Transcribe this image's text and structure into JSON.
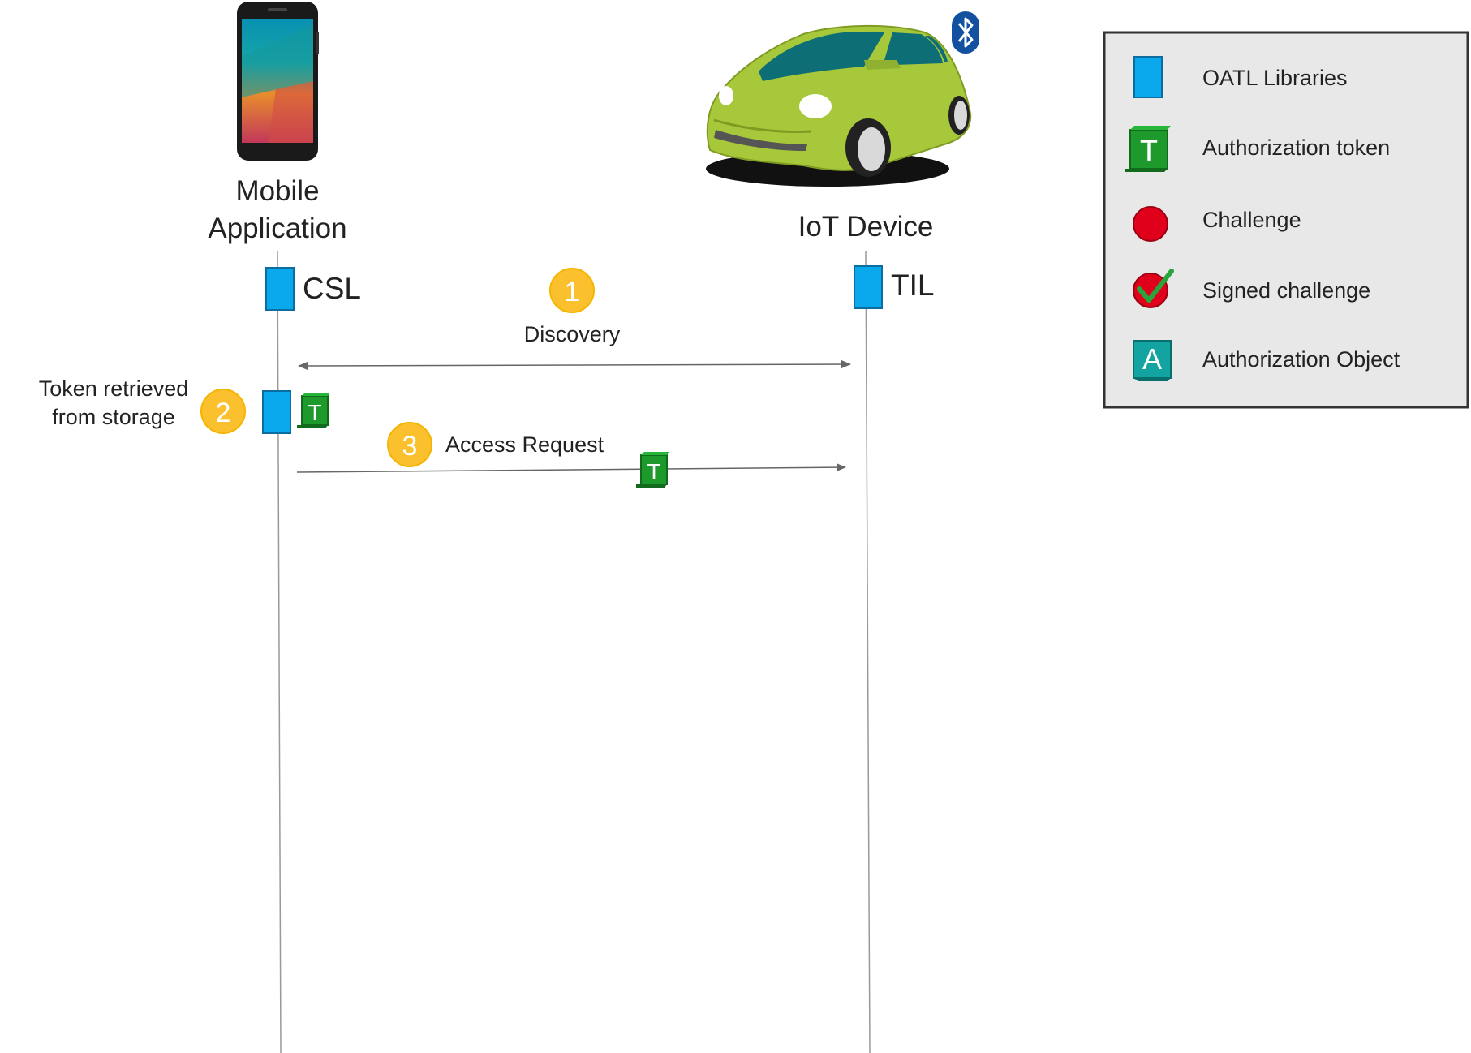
{
  "actors": {
    "mobile": {
      "label_line1": "Mobile",
      "label_line2": "Application",
      "library": "CSL"
    },
    "iot": {
      "label": "IoT Device",
      "library": "TIL"
    }
  },
  "steps": [
    {
      "number": "1",
      "label": "Discovery"
    },
    {
      "number": "2",
      "label_line1": "Token retrieved",
      "label_line2": "from storage"
    },
    {
      "number": "3",
      "label": "Access Request"
    }
  ],
  "legend": {
    "items": [
      {
        "icon": "oatl-library-icon",
        "label": "OATL Libraries"
      },
      {
        "icon": "authorization-token-icon",
        "label": "Authorization token",
        "glyph": "T"
      },
      {
        "icon": "challenge-icon",
        "label": "Challenge"
      },
      {
        "icon": "signed-challenge-icon",
        "label": "Signed challenge"
      },
      {
        "icon": "authorization-object-icon",
        "label": "Authorization Object",
        "glyph": "A"
      }
    ]
  },
  "colors": {
    "library_blue": "#0aa8ec",
    "token_green": "#1e9a2c",
    "step_badge": "#fbc02d",
    "challenge_red": "#e0001b",
    "auth_object_teal": "#13a3a0",
    "car_body": "#a6c83a",
    "bluetooth_blue": "#1350a0",
    "legend_bg": "#e8e8e8"
  }
}
